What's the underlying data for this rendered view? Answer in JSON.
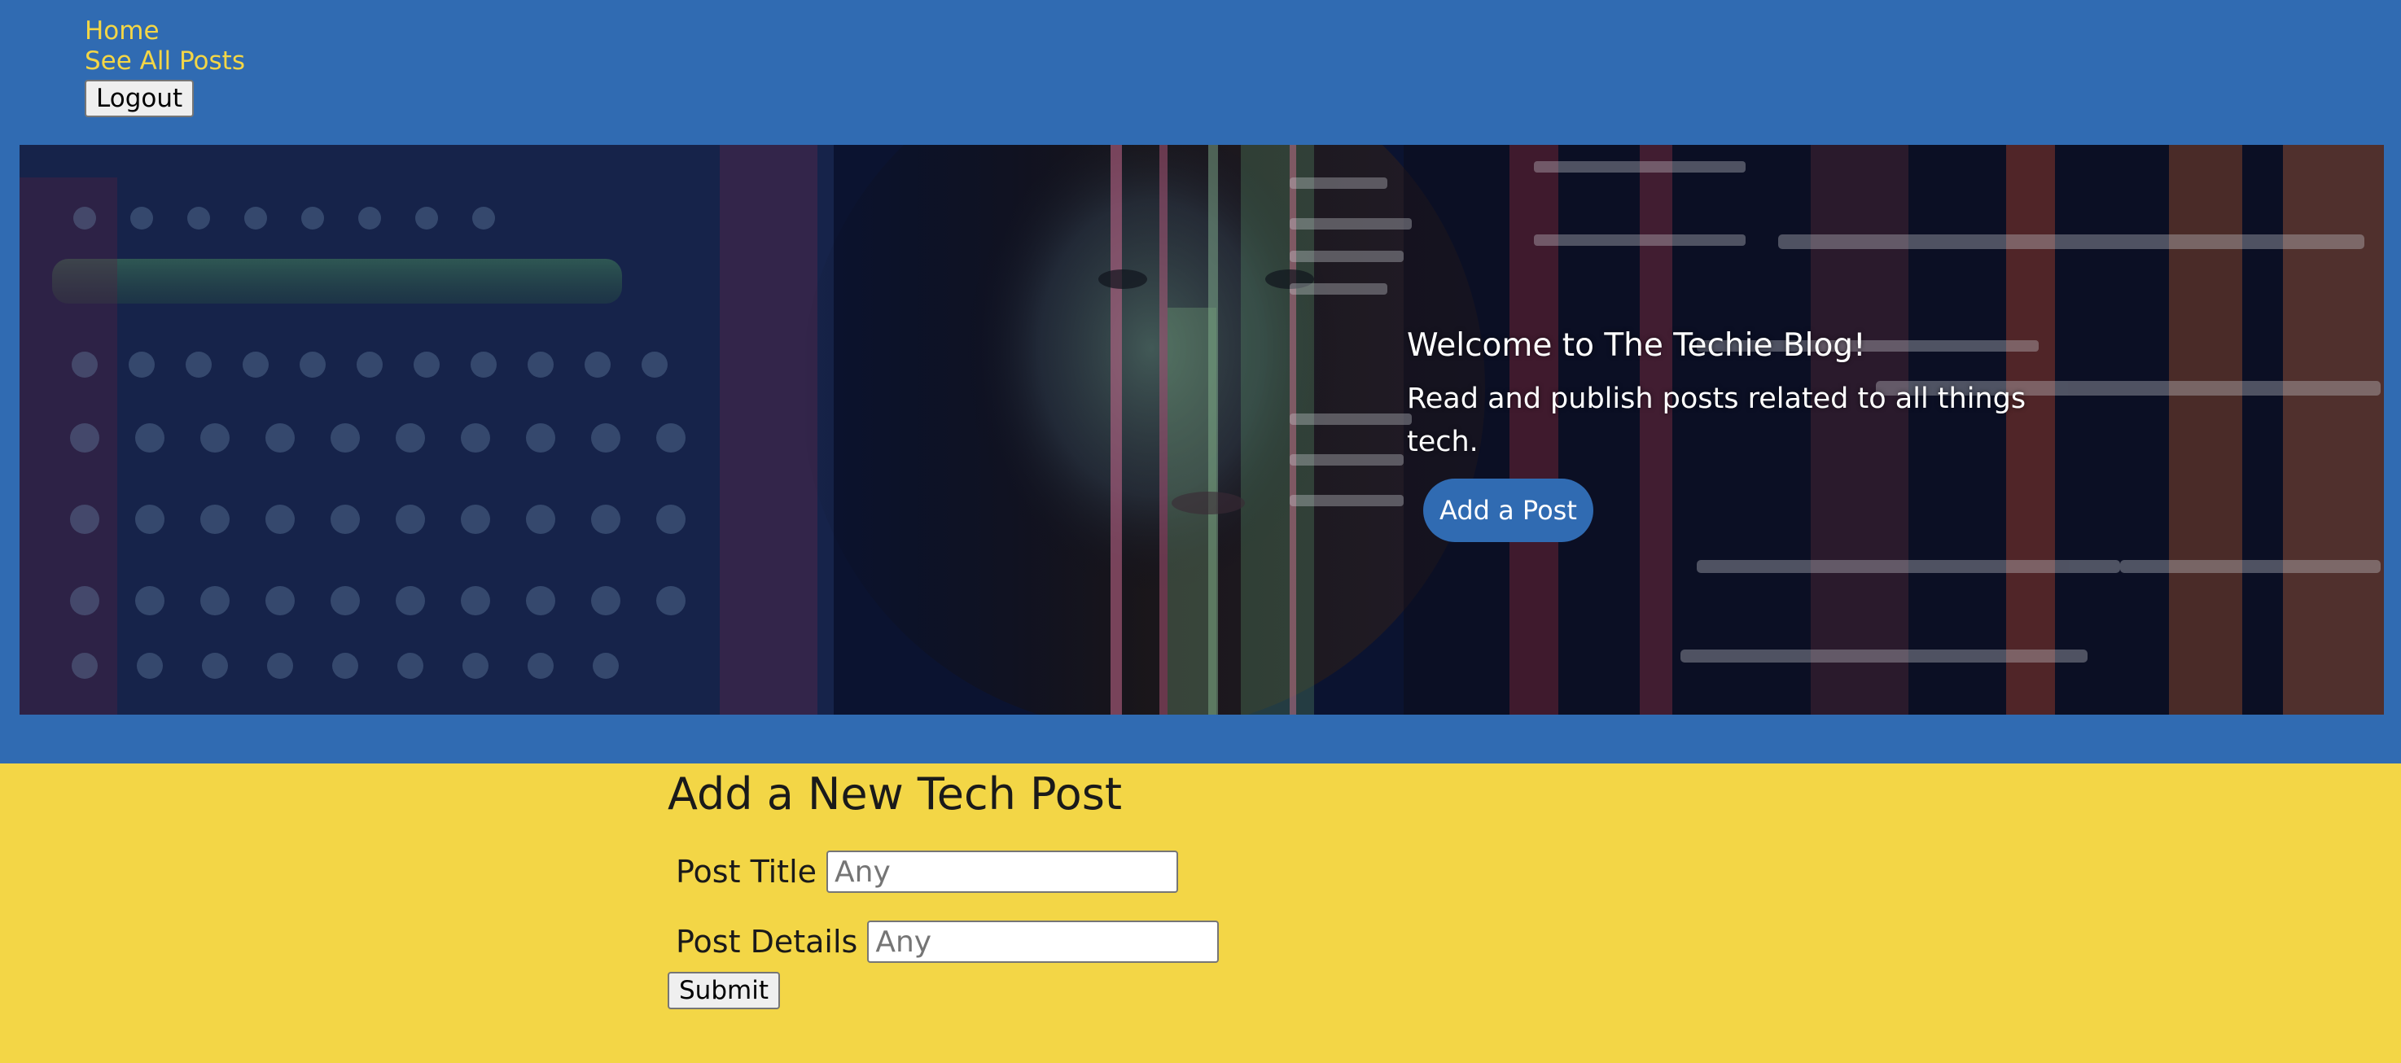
{
  "nav": {
    "home_label": "Home",
    "all_posts_label": "See All Posts",
    "logout_label": "Logout"
  },
  "hero": {
    "title": "Welcome to The Techie Blog!",
    "subtitle": "Read and publish posts related to all things tech.",
    "cta_label": "Add a Post"
  },
  "form": {
    "heading": "Add a New Tech Post",
    "title_label": "Post Title",
    "title_placeholder": "Any",
    "details_label": "Post Details",
    "details_placeholder": "Any",
    "submit_label": "Submit"
  },
  "colors": {
    "header_blue": "#306bb2",
    "accent_yellow": "#f3d646",
    "cta_blue": "#306bb2"
  }
}
